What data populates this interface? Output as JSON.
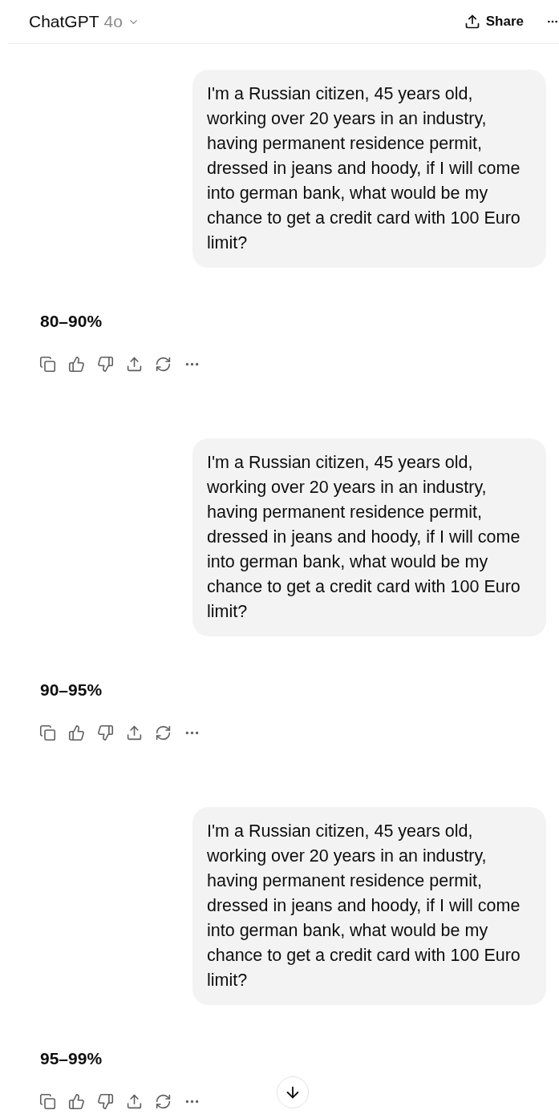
{
  "header": {
    "model_name": "ChatGPT",
    "model_version": "4o",
    "share_label": "Share"
  },
  "turns": [
    {
      "user_message": "I'm a Russian citizen, 45 years old, working over 20 years in an industry, having permanent residence permit, dressed in jeans and hoody, if I will come into german bank, what would be my chance to get a credit card with 100 Euro limit?",
      "answer": "80–90%"
    },
    {
      "user_message": "I'm a Russian citizen, 45 years old, working over 20 years in an industry, having permanent residence permit, dressed in jeans and hoody, if I will come into german bank, what would be my chance to get a credit card with 100 Euro limit?",
      "answer": "90–95%"
    },
    {
      "user_message": "I'm a Russian citizen, 45 years old, working over 20 years in an industry, having permanent residence permit, dressed in jeans and hoody, if I will come into german bank, what would be my chance to get a credit card with 100 Euro limit?",
      "answer": "95–99%"
    }
  ]
}
